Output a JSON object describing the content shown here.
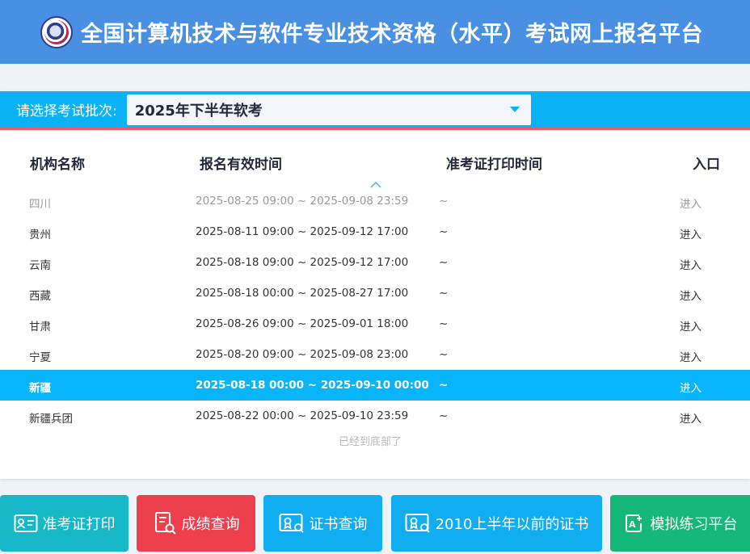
{
  "header": {
    "title": "全国计算机技术与软件专业技术资格（水平）考试网上报名平台",
    "logo_icon": "exam-logo"
  },
  "selector": {
    "label": "请选择考试批次:",
    "value": "2025年下半年软考"
  },
  "table": {
    "columns": [
      "机构名称",
      "报名有效时间",
      "准考证打印时间",
      "入口"
    ],
    "rows": [
      {
        "name": "四川",
        "reg_time": "2025-08-25 09:00 ~ 2025-09-08 23:59",
        "print_time": "~",
        "entry": "进入"
      },
      {
        "name": "贵州",
        "reg_time": "2025-08-11 09:00 ~ 2025-09-12 17:00",
        "print_time": "~",
        "entry": "进入"
      },
      {
        "name": "云南",
        "reg_time": "2025-08-18 09:00 ~ 2025-09-12 17:00",
        "print_time": "~",
        "entry": "进入"
      },
      {
        "name": "西藏",
        "reg_time": "2025-08-18 00:00 ~ 2025-08-27 17:00",
        "print_time": "~",
        "entry": "进入"
      },
      {
        "name": "甘肃",
        "reg_time": "2025-08-26 09:00 ~ 2025-09-01 18:00",
        "print_time": "~",
        "entry": "进入"
      },
      {
        "name": "宁夏",
        "reg_time": "2025-08-20 09:00 ~ 2025-09-08 23:00",
        "print_time": "~",
        "entry": "进入"
      },
      {
        "name": "新疆",
        "reg_time": "2025-08-18 00:00 ~ 2025-09-10 00:00",
        "print_time": "~",
        "entry": "进入"
      },
      {
        "name": "新疆兵团",
        "reg_time": "2025-08-22 00:00 ~ 2025-09-10 23:59",
        "print_time": "~",
        "entry": "进入"
      }
    ],
    "end_text": "已经到底部了"
  },
  "buttons": [
    {
      "label": "准考证打印",
      "icon": "id-card-icon",
      "color": "#16b8c8"
    },
    {
      "label": "成绩查询",
      "icon": "score-report-icon",
      "color": "#ee3f4d"
    },
    {
      "label": "证书查询",
      "icon": "certificate-icon",
      "color": "#10aef0"
    },
    {
      "label": "2010上半年以前的证书",
      "icon": "certificate-icon",
      "color": "#10aef0"
    },
    {
      "label": "模拟练习平台",
      "icon": "practice-edit-icon",
      "color": "#16b87a"
    }
  ],
  "colors": {
    "header_bg": "#4a90e2",
    "selector_bg": "#0bb2f5",
    "selector_underline": "#f05a5a",
    "active_row": "#09b5fa"
  }
}
